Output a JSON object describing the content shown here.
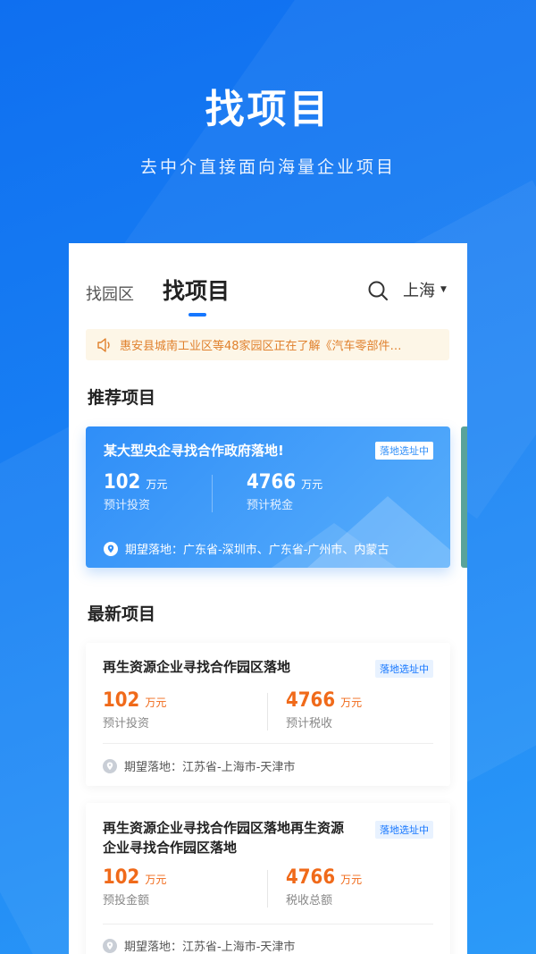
{
  "hero": {
    "title": "找项目",
    "subtitle": "去中介直接面向海量企业项目"
  },
  "tabs": [
    {
      "label": "找园区"
    },
    {
      "label": "找项目"
    }
  ],
  "city": "上海",
  "notice": "惠安县城南工业区等48家园区正在了解《汽车零部件…",
  "sections": {
    "recommended": "推荐项目",
    "latest": "最新项目"
  },
  "recommended": {
    "title": "某大型央企寻找合作政府落地!",
    "badge": "落地选址中",
    "invest_value": "102",
    "invest_unit": "万元",
    "invest_label": "预计投资",
    "tax_value": "4766",
    "tax_unit": "万元",
    "tax_label": "预计税金",
    "location": "期望落地：广东省-深圳市、广东省-广州市、内蒙古"
  },
  "items": [
    {
      "title": "再生资源企业寻找合作园区落地",
      "badge": "落地选址中",
      "v1": "102",
      "u1": "万元",
      "l1": "预计投资",
      "v2": "4766",
      "u2": "万元",
      "l2": "预计税收",
      "location": "期望落地：江苏省-上海市-天津市"
    },
    {
      "title": "再生资源企业寻找合作园区落地再生资源企业寻找合作园区落地",
      "badge": "落地选址中",
      "v1": "102",
      "u1": "万元",
      "l1": "预投金额",
      "v2": "4766",
      "u2": "万元",
      "l2": "税收总额",
      "location": "期望落地：江苏省-上海市-天津市"
    }
  ],
  "colors": {
    "brand": "#1677ff",
    "accent_orange": "#f06a1a",
    "notice_text": "#e0802c"
  }
}
